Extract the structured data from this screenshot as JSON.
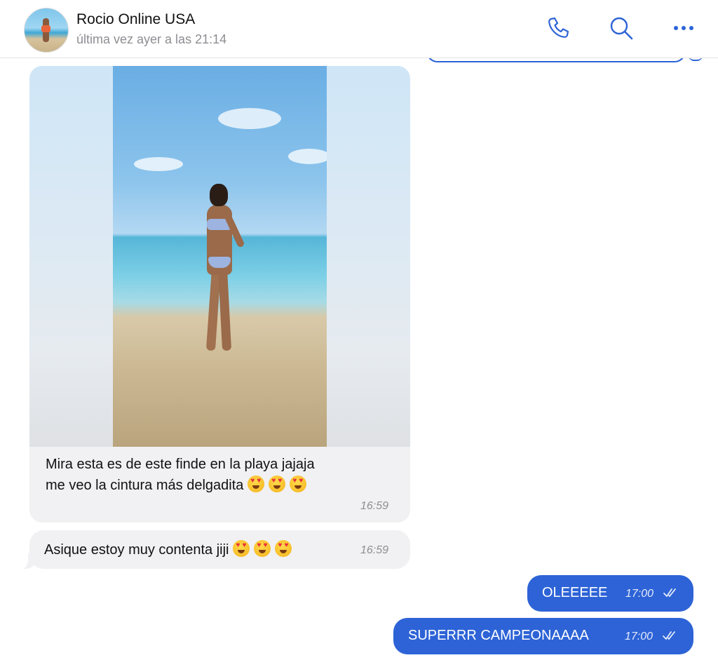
{
  "header": {
    "contact_name": "Rocio Online USA",
    "last_seen": "última vez ayer a las 21:14",
    "actions": [
      {
        "name": "call",
        "icon": "phone-icon"
      },
      {
        "name": "search",
        "icon": "search-icon"
      },
      {
        "name": "more",
        "icon": "more-dots-icon"
      }
    ]
  },
  "messages": [
    {
      "direction": "incoming",
      "type": "photo",
      "caption_line1": "Mira esta es de este finde en la playa jajaja",
      "caption_line2": "me veo la cintura más delgadita",
      "emoji": [
        "heart-eyes-emoji",
        "heart-eyes-emoji",
        "heart-eyes-emoji"
      ],
      "time": "16:59"
    },
    {
      "direction": "incoming",
      "type": "text",
      "text": "Asique estoy muy contenta jiji",
      "emoji": [
        "heart-eyes-emoji",
        "heart-eyes-emoji",
        "heart-eyes-emoji"
      ],
      "time": "16:59"
    },
    {
      "direction": "outgoing",
      "type": "text",
      "text": "OLEEEEE",
      "time": "17:00",
      "status": "read"
    },
    {
      "direction": "outgoing",
      "type": "text",
      "text": "SUPERRR CAMPEONAAAA",
      "time": "17:00",
      "status": "read"
    }
  ],
  "colors": {
    "accent": "#2d63d6",
    "incoming_bubble": "#f1f1f3",
    "secondary_text": "#8e8e93"
  }
}
